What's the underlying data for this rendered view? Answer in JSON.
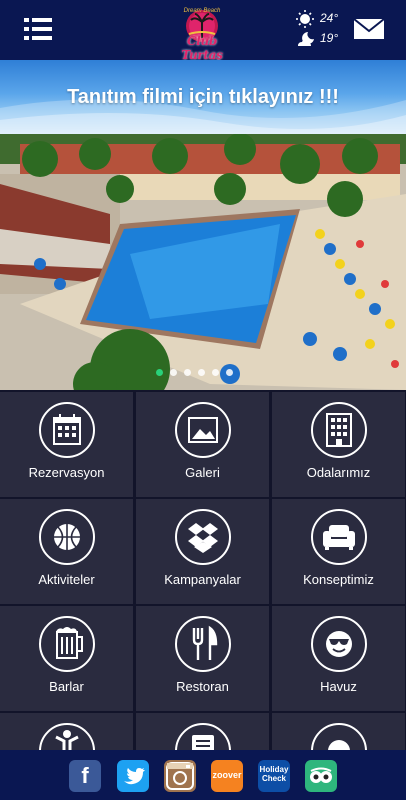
{
  "header": {
    "menu_icon": "hamburger-list-icon",
    "logo": {
      "script": "Club Turtaş",
      "tagline": "Dream Beach"
    },
    "weather": {
      "day_temp": "24°",
      "night_temp": "19°",
      "day_icon": "sun-icon",
      "night_icon": "moon-cloud-icon"
    },
    "mail_icon": "envelope-icon"
  },
  "banner": {
    "title": "Tanıtım filmi için tıklayınız !!!",
    "bg": "#5aa5ea"
  },
  "slider": {
    "slides": 6,
    "active": 0,
    "active_color": "#29d27a"
  },
  "menu": {
    "tiles": [
      {
        "label": "Rezervasyon",
        "icon": "calendar-icon"
      },
      {
        "label": "Galeri",
        "icon": "picture-icon"
      },
      {
        "label": "Odalarımız",
        "icon": "building-icon"
      },
      {
        "label": "Aktiviteler",
        "icon": "basketball-icon"
      },
      {
        "label": "Kampanyalar",
        "icon": "dropbox-icon"
      },
      {
        "label": "Konseptimiz",
        "icon": "sofa-icon"
      },
      {
        "label": "Barlar",
        "icon": "beer-mug-icon"
      },
      {
        "label": "Restoran",
        "icon": "fork-knife-icon"
      },
      {
        "label": "Havuz",
        "icon": "sunglasses-smile-icon"
      },
      {
        "label": "",
        "icon": "person-icon"
      },
      {
        "label": "",
        "icon": "list-icon"
      },
      {
        "label": "",
        "icon": "half-circle-icon"
      }
    ]
  },
  "footer": {
    "links": [
      {
        "name": "facebook",
        "text": "f",
        "icon": "facebook-icon",
        "color": "#3b5998"
      },
      {
        "name": "twitter",
        "text": "",
        "icon": "twitter-bird-icon",
        "color": "#1da1f2"
      },
      {
        "name": "instagram",
        "text": "",
        "icon": "instagram-camera-icon",
        "color": "#a0744f"
      },
      {
        "name": "zoover",
        "text": "zoover",
        "icon": "zoover-logo",
        "color": "#f58220"
      },
      {
        "name": "holidaycheck",
        "text": "Holiday Check",
        "icon": "holidaycheck-logo",
        "color": "#0d4ea6"
      },
      {
        "name": "tripadvisor",
        "text": "",
        "icon": "tripadvisor-owl-icon",
        "color": "#2eb67d"
      }
    ]
  }
}
